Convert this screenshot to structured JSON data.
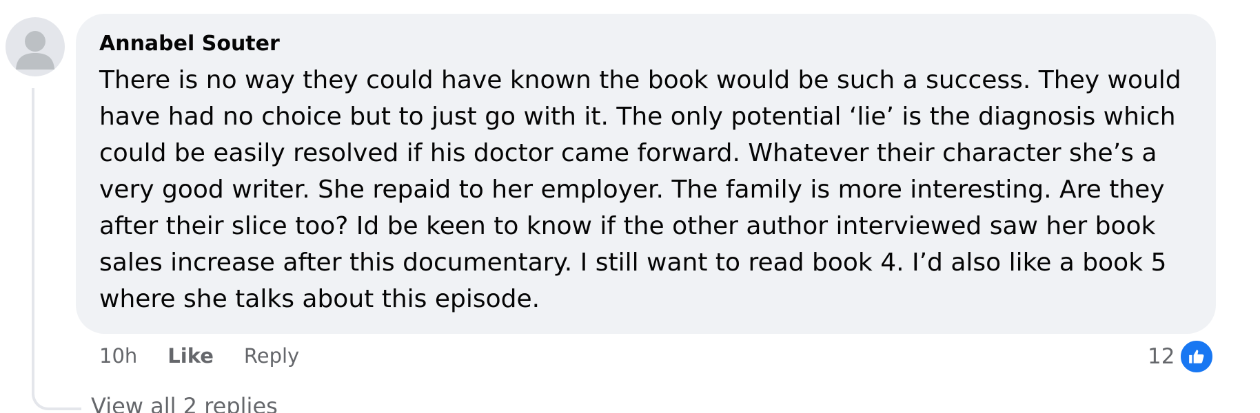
{
  "comment": {
    "author": "Annabel Souter",
    "text": "There is no way they could have known the book would be such a success. They would have had no choice but to just go with it. The only potential ‘lie’ is the diagnosis which could be easily resolved if his doctor came forward. Whatever their character she’s a very good writer. She repaid to her employer. The family is more interesting. Are they after their slice too? Id be keen to know if the other author interviewed saw her book sales increase after this documentary. I still want to read book 4. I’d also like a book 5 where she talks about this episode."
  },
  "actions": {
    "timestamp": "10h",
    "like_label": "Like",
    "reply_label": "Reply"
  },
  "reactions": {
    "count": "12",
    "icon": "thumbs-up-icon"
  },
  "replies": {
    "view_all_label": "View all 2 replies"
  },
  "colors": {
    "bubble_bg": "#f0f2f5",
    "secondary_text": "#65676b",
    "like_blue": "#1877f2"
  }
}
